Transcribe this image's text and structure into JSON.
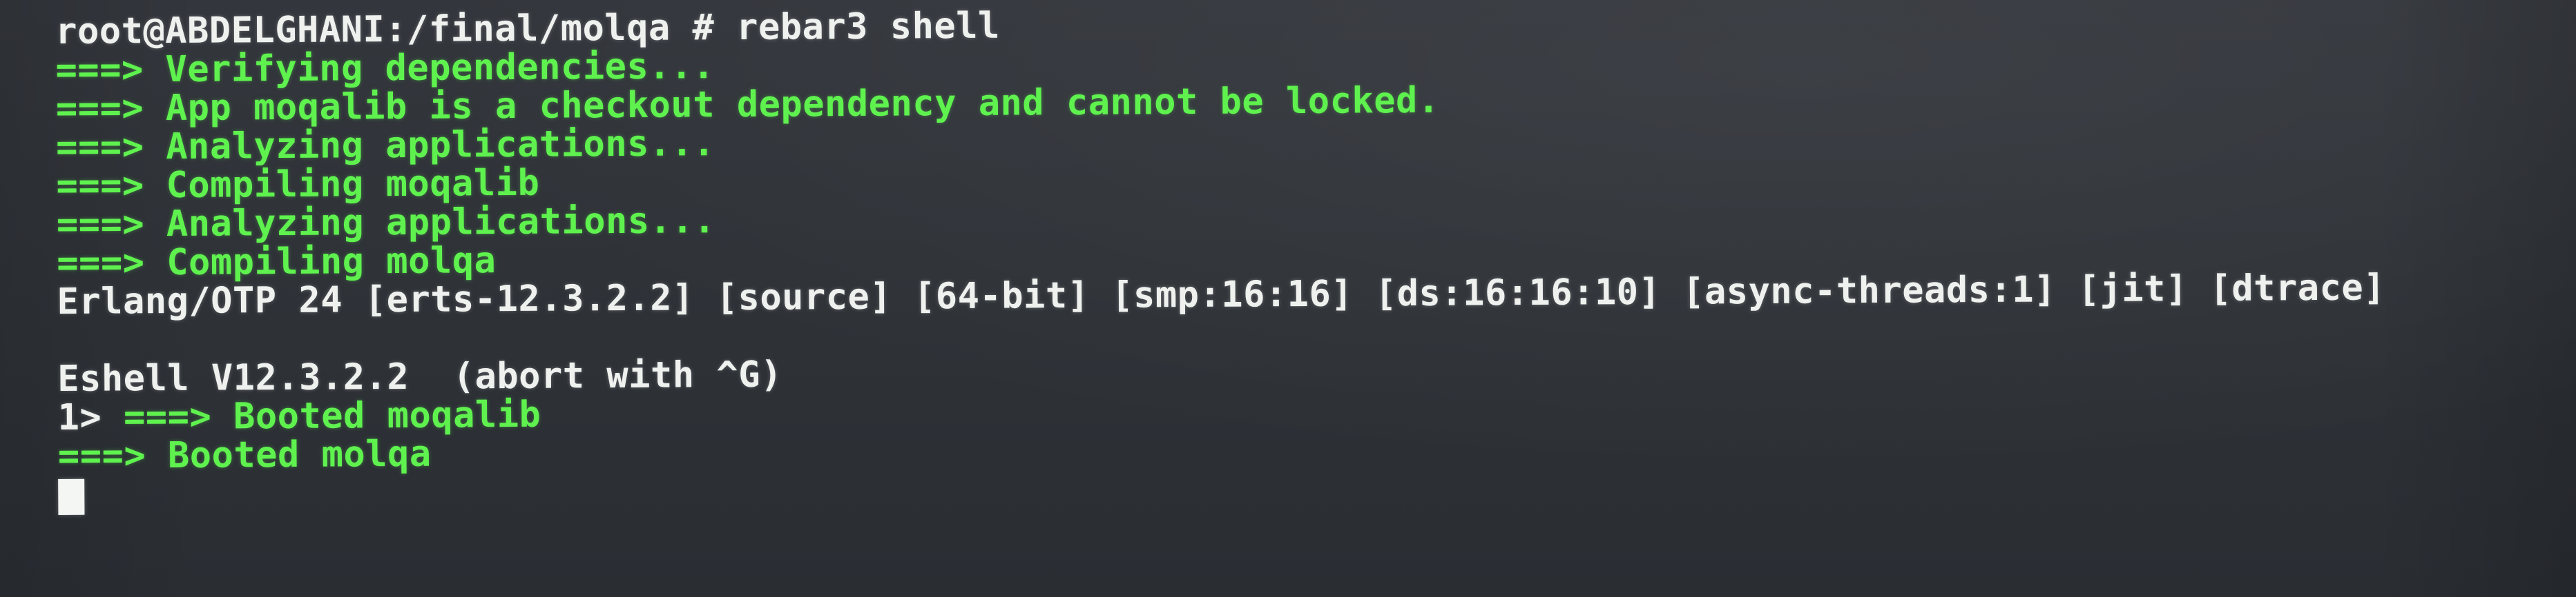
{
  "terminal": {
    "prompt": "root@ABDELGHANI:/final/molqa # rebar3 shell",
    "rebar_output": [
      "===> Verifying dependencies...",
      "===> App moqalib is a checkout dependency and cannot be locked.",
      "===> Analyzing applications...",
      "===> Compiling moqalib",
      "===> Analyzing applications...",
      "===> Compiling molqa"
    ],
    "erlang_banner": "Erlang/OTP 24 [erts-12.3.2.2] [source] [64-bit] [smp:16:16] [ds:16:16:10] [async-threads:1] [jit] [dtrace]",
    "eshell_banner": "Eshell V12.3.2.2  (abort with ^G)",
    "shell_prompt": "1> ",
    "boot_line_1": "===> Booted moqalib",
    "boot_line_2": "===> Booted molqa"
  },
  "colors": {
    "background": "#2f3338",
    "text_white": "#eef1ee",
    "text_green": "#5ff24f"
  }
}
